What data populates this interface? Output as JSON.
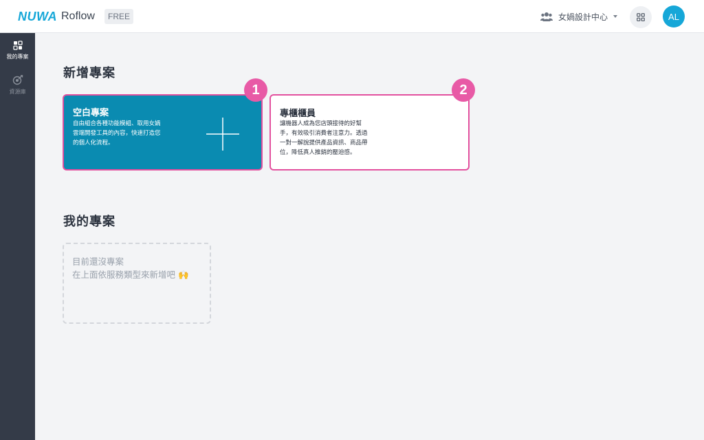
{
  "header": {
    "logo_mark": "NUWA",
    "app_name": "Roflow",
    "plan_badge": "FREE",
    "workspace_name": "女媧設計中心",
    "avatar_initials": "AL"
  },
  "sidebar": {
    "items": [
      {
        "label": "我的專案",
        "icon": "grid-icon",
        "active": true
      },
      {
        "label": "資源庫",
        "icon": "resource-icon",
        "active": false
      }
    ]
  },
  "main": {
    "new_project_title": "新增專案",
    "my_projects_title": "我的專案",
    "cards": [
      {
        "title": "空白專案",
        "desc_lines": [
          "自由組合各種功能模組、取用女媧",
          "雲端開發工具的內容，快速打造您",
          "的個人化流程。"
        ],
        "step": "1"
      },
      {
        "title": "專櫃櫃員",
        "desc_lines": [
          "讓機器人成為您店頭接待的好幫",
          "手，有效吸引消費者注意力。透過",
          "一對一解說提供產品資訊、商品帶",
          "位，降低真人推銷的壓迫感。"
        ],
        "step": "2"
      }
    ],
    "empty_state": {
      "line1": "目前還沒專案",
      "line2": "在上面依服務類型來新增吧 🙌"
    }
  },
  "colors": {
    "brand": "#16a7d8",
    "card_blue": "#0a8bb1",
    "highlight_pink": "#e3509e",
    "sidebar_bg": "#343b48"
  }
}
